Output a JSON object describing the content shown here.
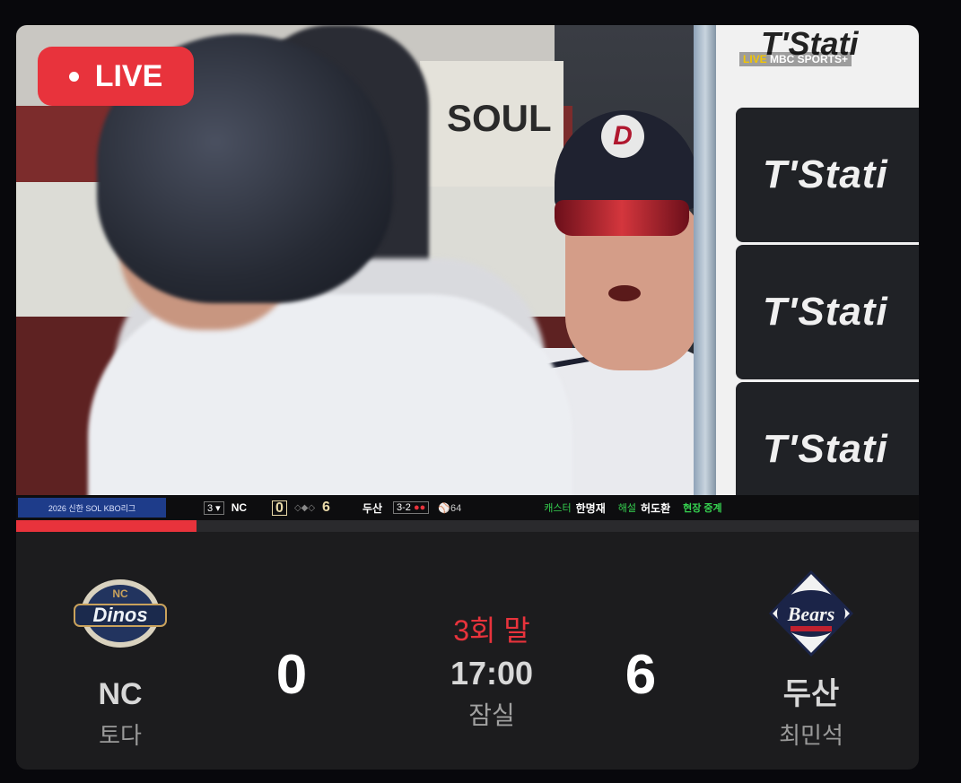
{
  "stream": {
    "live_label": "LIVE",
    "progress": 0.2
  },
  "broadcast": {
    "watermark": "LIVE MBC SPORTS+",
    "ad_text": "T'Stati",
    "scorebar": {
      "league": "2026 신한 SOL KBO리그",
      "inning": "3 ▾",
      "away_team": "NC",
      "away_score": "0",
      "home_score": "6",
      "home_team": "두산",
      "count": "3-2",
      "pitch_count": "⚾64",
      "caster_label": "캐스터",
      "caster_name": "한명재",
      "analyst_label": "해설",
      "analyst_name": "허도환",
      "live_label": "현장 중계"
    }
  },
  "game": {
    "away": {
      "name": "NC",
      "pitcher": "토다",
      "score": "0",
      "logo_text": "Dinos"
    },
    "home": {
      "name": "두산",
      "pitcher": "최민석",
      "score": "6",
      "logo_text": "Bears"
    },
    "inning": "3회 말",
    "time": "17:00",
    "venue": "잠실"
  },
  "colors": {
    "accent": "#e8333c",
    "card_bg": "#1c1c1e"
  }
}
